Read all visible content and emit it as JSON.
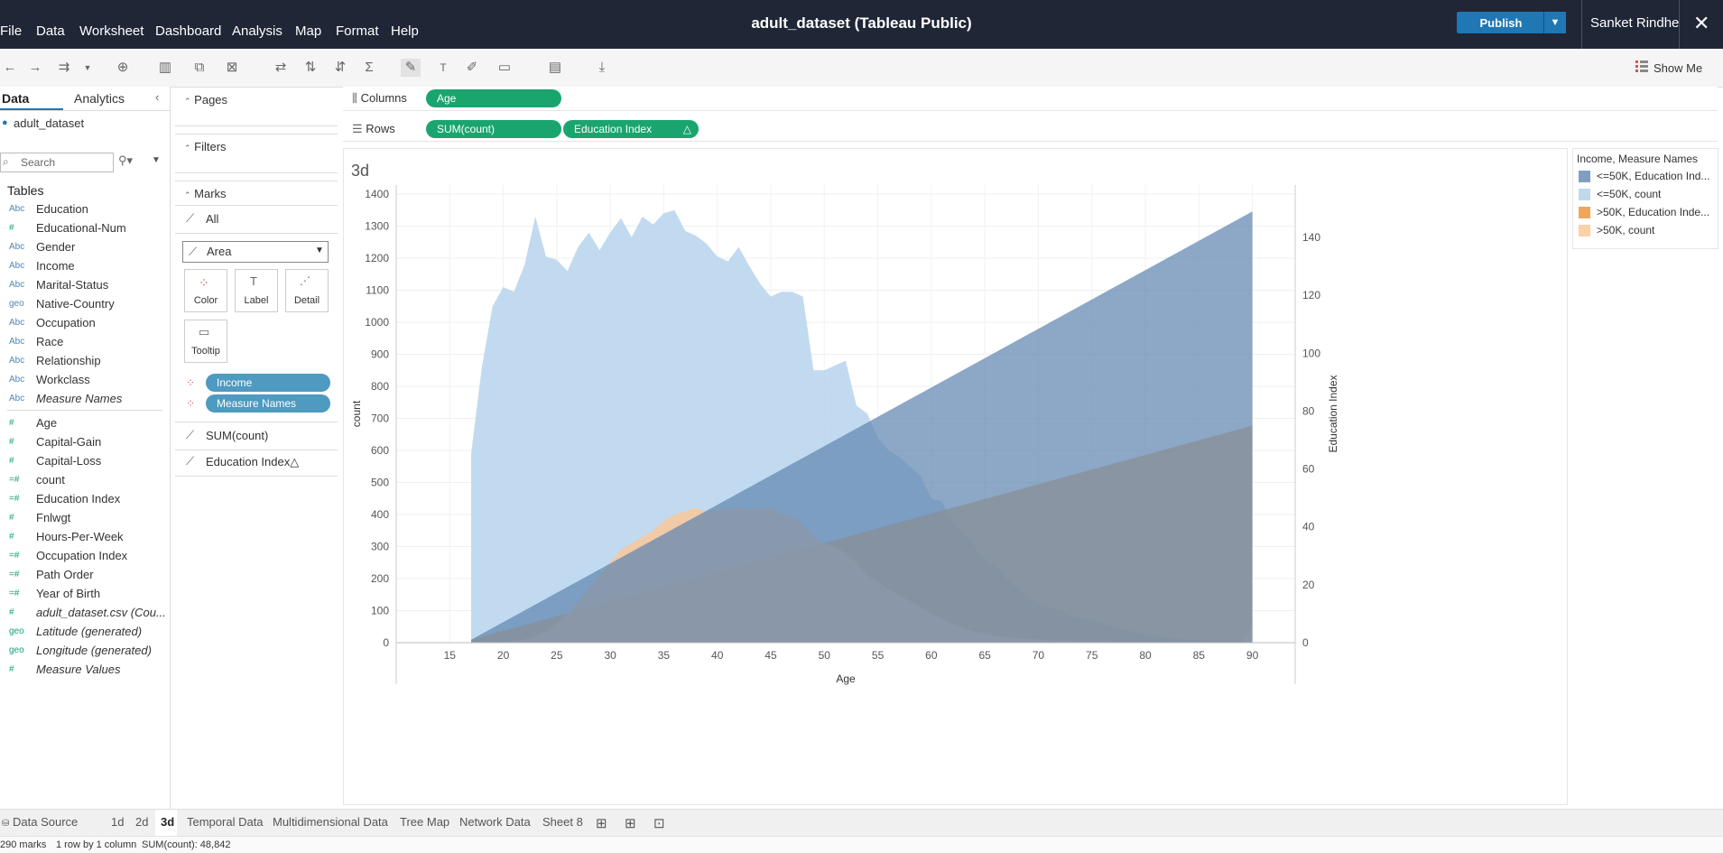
{
  "menu": [
    "File",
    "Data",
    "Worksheet",
    "Dashboard",
    "Analysis",
    "Map",
    "Format",
    "Help"
  ],
  "app_title": "adult_dataset (Tableau Public)",
  "publish_label": "Publish",
  "user_name": "Sanket Rindhe",
  "show_me_label": "Show Me",
  "left": {
    "tab_data": "Data",
    "tab_analytics": "Analytics",
    "datasource": "adult_dataset",
    "search_placeholder": "Search",
    "tables_label": "Tables",
    "dimensions": [
      {
        "type": "Abc",
        "name": "Education"
      },
      {
        "type": "#",
        "name": "Educational-Num"
      },
      {
        "type": "Abc",
        "name": "Gender"
      },
      {
        "type": "Abc",
        "name": "Income"
      },
      {
        "type": "Abc",
        "name": "Marital-Status"
      },
      {
        "type": "geo",
        "name": "Native-Country"
      },
      {
        "type": "Abc",
        "name": "Occupation"
      },
      {
        "type": "Abc",
        "name": "Race"
      },
      {
        "type": "Abc",
        "name": "Relationship"
      },
      {
        "type": "Abc",
        "name": "Workclass"
      },
      {
        "type": "Abc",
        "name": "Measure Names"
      }
    ],
    "measures": [
      {
        "type": "#",
        "name": "Age"
      },
      {
        "type": "#",
        "name": "Capital-Gain"
      },
      {
        "type": "#",
        "name": "Capital-Loss"
      },
      {
        "type": "=#",
        "name": "count"
      },
      {
        "type": "=#",
        "name": "Education Index"
      },
      {
        "type": "#",
        "name": "Fnlwgt"
      },
      {
        "type": "#",
        "name": "Hours-Per-Week"
      },
      {
        "type": "=#",
        "name": "Occupation Index"
      },
      {
        "type": "=#",
        "name": "Path Order"
      },
      {
        "type": "=#",
        "name": "Year of Birth"
      },
      {
        "type": "#",
        "name": "adult_dataset.csv (Cou..."
      },
      {
        "type": "geo",
        "name": "Latitude (generated)"
      },
      {
        "type": "geo",
        "name": "Longitude (generated)"
      },
      {
        "type": "#",
        "name": "Measure Values"
      }
    ]
  },
  "cards": {
    "pages": "Pages",
    "filters": "Filters",
    "marks": "Marks",
    "all": "All",
    "mark_type": "Area",
    "color": "Color",
    "label": "Label",
    "detail": "Detail",
    "tooltip": "Tooltip",
    "pill_income": "Income",
    "pill_measure_names": "Measure Names",
    "sum_count": "SUM(count)",
    "education_index": "Education Index△"
  },
  "shelves": {
    "columns_label": "Columns",
    "rows_label": "Rows",
    "col_pill": "Age",
    "row_pill1": "SUM(count)",
    "row_pill2": "Education Index",
    "row_pill2_icon": "△"
  },
  "view_title": "3d",
  "legend": {
    "title": "Income, Measure Names",
    "items": [
      {
        "label": "<=50K, Education Ind...",
        "color": "#7f9ec0"
      },
      {
        "label": "<=50K, count",
        "color": "#c0d8ec"
      },
      {
        "label": ">50K, Education Inde...",
        "color": "#f2a55a"
      },
      {
        "label": ">50K, count",
        "color": "#fbd1a6"
      }
    ]
  },
  "sheet_tabs": [
    "Data Source",
    "1d",
    "2d",
    "3d",
    "Temporal Data",
    "Multidimensional Data",
    "Tree Map",
    "Network Data",
    "Sheet 8"
  ],
  "active_tab": "3d",
  "status": {
    "marks": "290 marks",
    "rows_cols": "1 row by 1 column",
    "sum": "SUM(count): 48,842"
  },
  "chart_data": {
    "type": "area",
    "xlabel": "Age",
    "ylabel": "count",
    "y2label": "Education Index",
    "xlim": [
      10,
      94
    ],
    "ylim": [
      0,
      1400
    ],
    "y2lim": [
      0,
      155
    ],
    "x_ticks": [
      15,
      20,
      25,
      30,
      35,
      40,
      45,
      50,
      55,
      60,
      65,
      70,
      75,
      80,
      85,
      90
    ],
    "y_ticks": [
      0,
      100,
      200,
      300,
      400,
      500,
      600,
      700,
      800,
      900,
      1000,
      1100,
      1200,
      1300,
      1400
    ],
    "y2_ticks": [
      0,
      20,
      40,
      60,
      80,
      100,
      120,
      140
    ],
    "series": [
      {
        "name": "<=50K, count",
        "axis": "left",
        "color": "#b7d3ec",
        "x": [
          17,
          18,
          19,
          20,
          21,
          22,
          23,
          24,
          25,
          26,
          27,
          28,
          29,
          30,
          31,
          32,
          33,
          34,
          35,
          36,
          37,
          38,
          39,
          40,
          41,
          42,
          43,
          44,
          45,
          46,
          47,
          48,
          49,
          50,
          51,
          52,
          53,
          54,
          55,
          56,
          57,
          58,
          59,
          60,
          61,
          62,
          63,
          64,
          65,
          66,
          67,
          68,
          69,
          70,
          71,
          72,
          73,
          74,
          75,
          76,
          77,
          78,
          79,
          80,
          81,
          82,
          83,
          84,
          85,
          86,
          87,
          88,
          89,
          90
        ],
        "y": [
          590,
          860,
          1050,
          1110,
          1095,
          1180,
          1330,
          1205,
          1195,
          1160,
          1235,
          1280,
          1225,
          1280,
          1325,
          1265,
          1330,
          1305,
          1340,
          1350,
          1285,
          1270,
          1245,
          1205,
          1190,
          1235,
          1175,
          1120,
          1080,
          1095,
          1095,
          1080,
          850,
          850,
          865,
          880,
          740,
          715,
          640,
          600,
          580,
          550,
          520,
          450,
          440,
          370,
          345,
          300,
          260,
          240,
          200,
          170,
          140,
          125,
          110,
          100,
          85,
          75,
          70,
          60,
          50,
          42,
          35,
          25,
          20,
          15,
          12,
          10,
          8,
          6,
          5,
          4,
          3,
          3
        ]
      },
      {
        "name": ">50K, count",
        "axis": "left",
        "color": "#f9c79b",
        "x": [
          17,
          18,
          19,
          20,
          21,
          22,
          23,
          24,
          25,
          26,
          27,
          28,
          29,
          30,
          31,
          32,
          33,
          34,
          35,
          36,
          37,
          38,
          39,
          40,
          41,
          42,
          43,
          44,
          45,
          46,
          47,
          48,
          49,
          50,
          51,
          52,
          53,
          54,
          55,
          56,
          57,
          58,
          59,
          60,
          61,
          62,
          63,
          64,
          65,
          66,
          67,
          68,
          69,
          70,
          71,
          72,
          73,
          74,
          75,
          76,
          77,
          78,
          79,
          80,
          81,
          82,
          83,
          84,
          85,
          86,
          87,
          88,
          89,
          90
        ],
        "y": [
          0,
          0,
          1,
          2,
          5,
          10,
          20,
          35,
          60,
          90,
          130,
          170,
          210,
          250,
          290,
          310,
          330,
          350,
          380,
          400,
          410,
          420,
          410,
          415,
          420,
          420,
          415,
          420,
          420,
          400,
          395,
          370,
          330,
          310,
          300,
          280,
          250,
          210,
          190,
          165,
          150,
          130,
          110,
          90,
          75,
          60,
          45,
          35,
          28,
          22,
          18,
          14,
          12,
          10,
          8,
          7,
          6,
          5,
          4,
          4,
          3,
          3,
          2,
          2,
          2,
          1,
          1,
          1,
          1,
          1,
          1,
          1,
          1,
          50
        ]
      },
      {
        "name": "<=50K, Education Index",
        "axis": "right",
        "color": "#5f86b0",
        "x": [
          17,
          90
        ],
        "y": [
          1,
          149
        ]
      },
      {
        "name": ">50K, Education Index",
        "axis": "right",
        "color": "#f0a050",
        "x": [
          17,
          90
        ],
        "y": [
          1,
          75
        ]
      }
    ]
  }
}
